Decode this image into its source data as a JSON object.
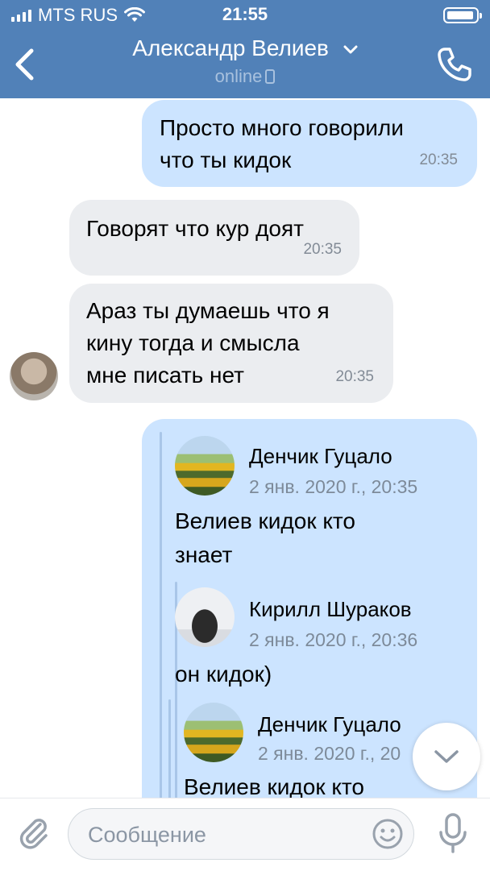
{
  "status_bar": {
    "carrier": "MTS RUS",
    "time": "21:55"
  },
  "header": {
    "title": "Александр Велиев",
    "subtitle": "online"
  },
  "messages": [
    {
      "line1": "Просто много говорили",
      "line2": "что ты кидок",
      "time": "20:35"
    },
    {
      "line1": "Говорят что кур доят",
      "time": "20:35"
    },
    {
      "line1": "Араз ты думаешь что я",
      "line2": "кину тогда и смысла",
      "line3": "мне писать нет",
      "time": "20:35"
    }
  ],
  "forwarded": [
    {
      "author": "Денчик Гуцало",
      "date": "2 янв. 2020 г., 20:35",
      "line1": "Велиев кидок кто",
      "line2": "знает"
    },
    {
      "author": "Кирилл Шураков",
      "date": "2 янв. 2020 г., 20:36",
      "line1": "он кидок)"
    },
    {
      "author": "Денчик Гуцало",
      "date": "2 янв. 2020 г., 20",
      "line1": "Велиев кидок кто"
    }
  ],
  "composer": {
    "placeholder": "Сообщение"
  },
  "colors": {
    "header": "#5181b8",
    "outgoing": "#cce4ff",
    "incoming": "#ebedf0"
  },
  "icons": [
    "back-icon",
    "chevron-down-icon",
    "phone-call-icon",
    "attach-icon",
    "smile-icon",
    "mic-icon",
    "scroll-down-icon"
  ]
}
